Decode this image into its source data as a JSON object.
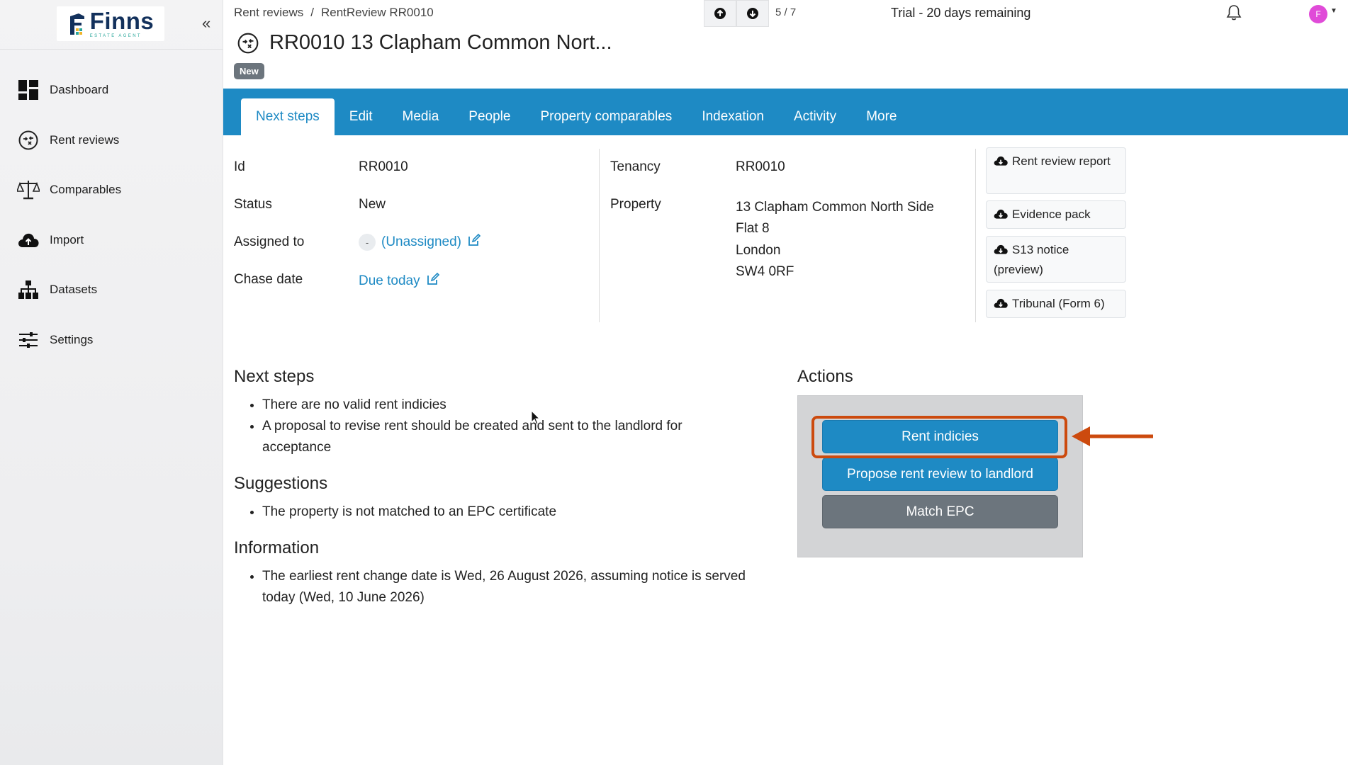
{
  "app": {
    "logo_name": "Finns",
    "logo_sub": "ESTATE AGENT",
    "collapse_label": "«"
  },
  "sidebar": {
    "items": [
      {
        "label": "Dashboard",
        "icon": "dashboard-icon"
      },
      {
        "label": "Rent reviews",
        "icon": "rent-reviews-icon"
      },
      {
        "label": "Comparables",
        "icon": "scales-icon"
      },
      {
        "label": "Import",
        "icon": "cloud-upload-icon"
      },
      {
        "label": "Datasets",
        "icon": "sitemap-icon"
      },
      {
        "label": "Settings",
        "icon": "sliders-icon"
      }
    ]
  },
  "header": {
    "breadcrumb": [
      "Rent reviews",
      "/",
      "RentReview RR0010"
    ],
    "pager": "5 / 7",
    "trial": "Trial - 20 days remaining",
    "avatar_initial": "F",
    "title": "RR0010 13 Clapham Common Nort...",
    "status_badge": "New"
  },
  "tabs": [
    "Next steps",
    "Edit",
    "Media",
    "People",
    "Property comparables",
    "Indexation",
    "Activity",
    "More"
  ],
  "details": {
    "id_label": "Id",
    "id_value": "RR0010",
    "status_label": "Status",
    "status_value": "New",
    "assigned_label": "Assigned to",
    "assigned_dash": "-",
    "assigned_value": "(Unassigned)",
    "chase_label": "Chase date",
    "chase_value": "Due today",
    "tenancy_label": "Tenancy",
    "tenancy_value": "RR0010",
    "property_label": "Property",
    "property_lines": [
      "13 Clapham Common North Side",
      "Flat 8",
      "London",
      "SW4 0RF"
    ]
  },
  "downloads": [
    "Rent review report",
    "Evidence pack",
    "S13 notice (preview)",
    "Tribunal (Form 6)"
  ],
  "next_steps": {
    "heading": "Next steps",
    "items": [
      "There are no valid rent indicies",
      "A proposal to revise rent should be created and sent to the landlord for acceptance"
    ]
  },
  "suggestions": {
    "heading": "Suggestions",
    "items": [
      "The property is not matched to an EPC certificate"
    ]
  },
  "information": {
    "heading": "Information",
    "items": [
      "The earliest rent change date is Wed, 26 August 2026, assuming notice is served today (Wed, 10 June 2026)"
    ]
  },
  "actions": {
    "heading": "Actions",
    "buttons": [
      "Rent indicies",
      "Propose rent review to landlord",
      "Match EPC"
    ]
  },
  "colors": {
    "primary": "#1e8ac4",
    "highlight": "#cc4a0e",
    "secondary": "#6c757d"
  }
}
